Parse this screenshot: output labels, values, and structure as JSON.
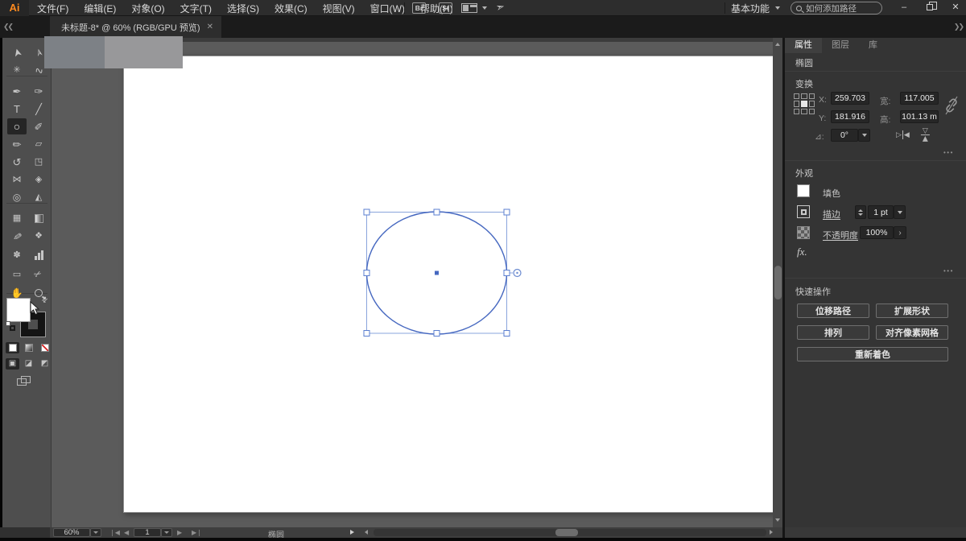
{
  "window": {
    "minimize_label": "–",
    "close_label": "✕"
  },
  "menu_bar": {
    "logo": "Ai",
    "items": [
      "文件(F)",
      "编辑(E)",
      "对象(O)",
      "文字(T)",
      "选择(S)",
      "效果(C)",
      "视图(V)",
      "窗口(W)",
      "帮助(H)"
    ],
    "item_names": [
      "file",
      "edit",
      "object",
      "type",
      "select",
      "effect",
      "view",
      "window",
      "help"
    ],
    "bridge_label": "Br",
    "stock_label": "St",
    "workspace_label": "基本功能",
    "search_placeholder": "如何添加路径"
  },
  "tab_bar": {
    "document_title": "未标题-8* @ 60% (RGB/GPU 预览)",
    "close_label": "✕"
  },
  "toolbar": {
    "tools": [
      {
        "name": "selection-tool",
        "glyph": "➤",
        "row": 0,
        "col": 0,
        "rot": -105
      },
      {
        "name": "direct-selection-tool",
        "glyph": "➢",
        "row": 0,
        "col": 1,
        "rot": -105
      },
      {
        "name": "magic-wand-tool",
        "glyph": "✳",
        "row": 1,
        "col": 0,
        "size": 11
      },
      {
        "name": "lasso-tool",
        "glyph": "∿",
        "row": 1,
        "col": 1,
        "rot": -15
      },
      {
        "name": "pen-tool",
        "glyph": "✒",
        "row": 2,
        "col": 0
      },
      {
        "name": "curvature-tool",
        "glyph": "✑",
        "row": 2,
        "col": 1
      },
      {
        "name": "type-tool",
        "glyph": "T",
        "row": 3,
        "col": 0
      },
      {
        "name": "line-segment-tool",
        "glyph": "╱",
        "row": 3,
        "col": 1
      },
      {
        "name": "ellipse-tool",
        "glyph": "○",
        "row": 4,
        "col": 0,
        "selected": true,
        "size": 14
      },
      {
        "name": "paintbrush-tool",
        "glyph": "✐",
        "row": 4,
        "col": 1
      },
      {
        "name": "shaper-tool",
        "glyph": "✏",
        "row": 5,
        "col": 0
      },
      {
        "name": "eraser-tool",
        "glyph": "▱",
        "row": 5,
        "col": 1,
        "size": 11
      },
      {
        "name": "rotate-tool",
        "glyph": "↺",
        "row": 6,
        "col": 0
      },
      {
        "name": "scale-tool",
        "glyph": "◳",
        "row": 6,
        "col": 1,
        "size": 11
      },
      {
        "name": "width-tool",
        "glyph": "⋈",
        "row": 7,
        "col": 0,
        "size": 11
      },
      {
        "name": "free-transform-tool",
        "glyph": "◈",
        "row": 7,
        "col": 1,
        "size": 11
      },
      {
        "name": "shape-builder-tool",
        "glyph": "◎",
        "row": 8,
        "col": 0,
        "size": 12
      },
      {
        "name": "perspective-grid-tool",
        "glyph": "◭",
        "row": 8,
        "col": 1,
        "size": 11
      },
      {
        "name": "mesh-tool",
        "glyph": "▦",
        "row": 9,
        "col": 0,
        "size": 11
      },
      {
        "name": "gradient-tool",
        "kind": "gradient",
        "row": 9,
        "col": 1
      },
      {
        "name": "eyedropper-tool",
        "glyph": "✎",
        "row": 10,
        "col": 0,
        "rot": 100
      },
      {
        "name": "blend-tool",
        "glyph": "❖",
        "row": 10,
        "col": 1,
        "size": 11
      },
      {
        "name": "symbol-sprayer-tool",
        "glyph": "✽",
        "row": 11,
        "col": 0,
        "size": 11
      },
      {
        "name": "column-graph-tool",
        "kind": "bars",
        "row": 11,
        "col": 1
      },
      {
        "name": "artboard-tool",
        "glyph": "▭",
        "row": 12,
        "col": 0,
        "size": 11
      },
      {
        "name": "slice-tool",
        "glyph": "✂",
        "row": 12,
        "col": 1,
        "rot": -30,
        "size": 11
      },
      {
        "name": "hand-tool",
        "glyph": "✋",
        "row": 13,
        "col": 0,
        "size": 12
      },
      {
        "name": "zoom-tool",
        "kind": "zoomglass",
        "row": 13,
        "col": 1
      }
    ]
  },
  "panel": {
    "tabs": [
      {
        "name": "properties",
        "label": "属性",
        "active": true
      },
      {
        "name": "layers",
        "label": "图层",
        "active": false
      },
      {
        "name": "libraries",
        "label": "库",
        "active": false
      }
    ],
    "collapse_glyph": "❯❯",
    "object_type": "椭圆",
    "transform": {
      "title": "变换",
      "x_label": "X:",
      "x_value": "259.703",
      "y_label": "Y:",
      "y_value": "181.916",
      "w_label": "宽:",
      "w_value": "117.005",
      "h_label": "高:",
      "h_value": "101.13 m",
      "angle_label": "⊿:",
      "angle_value": "0°",
      "more": "•••"
    },
    "appearance": {
      "title": "外观",
      "fill_label": "填色",
      "stroke_label": "描边",
      "stroke_value": "1 pt",
      "opacity_label": "不透明度",
      "opacity_value": "100%",
      "opacity_more": "›",
      "fx_label": "fx.",
      "more": "•••"
    },
    "quick_actions": {
      "title": "快速操作",
      "buttons": [
        {
          "name": "offset-path",
          "label": "位移路径"
        },
        {
          "name": "expand-shape",
          "label": "扩展形状"
        },
        {
          "name": "arrange",
          "label": "排列"
        },
        {
          "name": "align-pixel-grid",
          "label": "对齐像素网格"
        },
        {
          "name": "recolor",
          "label": "重新着色"
        }
      ]
    }
  },
  "status_bar": {
    "zoom_value": "60%",
    "page_value": "1",
    "status_text": "椭圆"
  },
  "colors": {
    "accent_blue": "#4668c0",
    "selection_blue": "#8aa4dc",
    "logo_orange": "#ff8a1e",
    "artboard": "#ffffff"
  }
}
